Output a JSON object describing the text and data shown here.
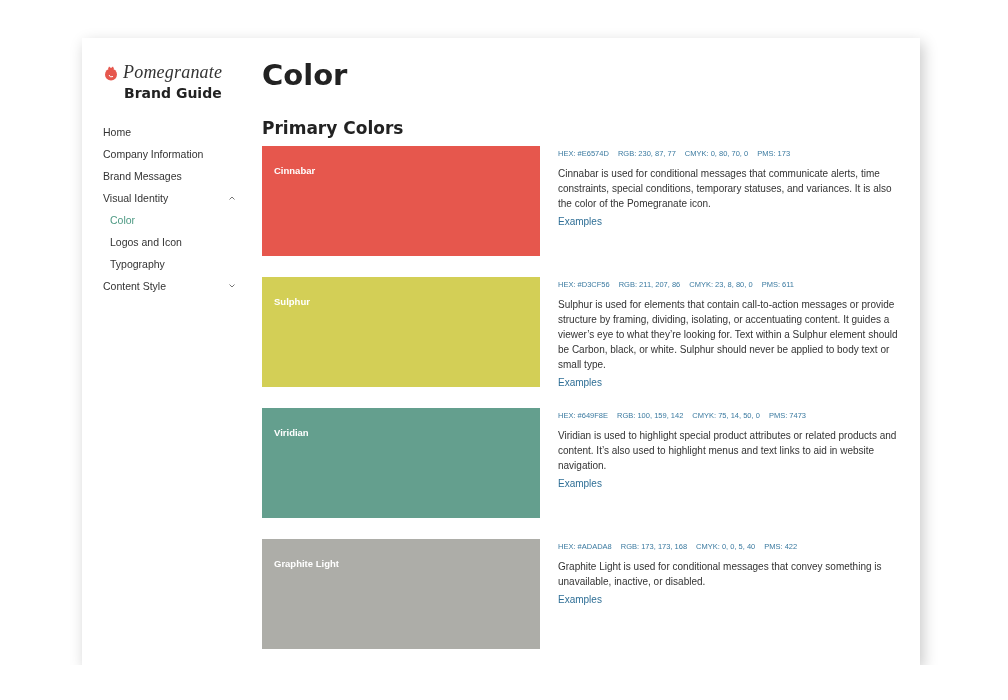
{
  "brand": {
    "name": "Pomegranate",
    "subtitle": "Brand Guide"
  },
  "nav": [
    {
      "label": "Home",
      "selected": false
    },
    {
      "label": "Company Information",
      "selected": false
    },
    {
      "label": "Brand Messages",
      "selected": false
    },
    {
      "label": "Visual Identity",
      "selected": false,
      "expanded": true,
      "children": [
        {
          "label": "Color",
          "selected": true
        },
        {
          "label": "Logos and Icon",
          "selected": false
        },
        {
          "label": "Typography",
          "selected": false
        }
      ]
    },
    {
      "label": "Content Style",
      "selected": false,
      "expanded": false
    }
  ],
  "page_title": "Color",
  "section_title": "Primary Colors",
  "colors": [
    {
      "name": "Cinnabar",
      "color": "#e6574d",
      "specs": [
        "HEX: #E6574D",
        "RGB: 230, 87, 77",
        "CMYK: 0, 80, 70, 0",
        "PMS: 173"
      ],
      "description": "Cinnabar is used for conditional messages that communicate alerts, time constraints, special conditions, temporary statuses, and variances. It is also the color of the Pomegranate icon.",
      "link": "Examples"
    },
    {
      "name": "Sulphur",
      "color": "#d3cf56",
      "specs": [
        "HEX: #D3CF56",
        "RGB: 211, 207, 86",
        "CMYK: 23, 8, 80, 0",
        "PMS: 611"
      ],
      "description": "Sulphur is used for elements that contain call-to-action messages or provide structure by framing, dividing, isolating, or accentuating content. It guides a viewer’s eye to what they’re looking for. Text within a Sulphur element should be Carbon, black, or white. Sulphur should never be applied to body text or small type.",
      "link": "Examples"
    },
    {
      "name": "Viridian",
      "color": "#649f8e",
      "specs": [
        "HEX: #649F8E",
        "RGB: 100, 159, 142",
        "CMYK: 75, 14, 50, 0",
        "PMS: 7473"
      ],
      "description": "Viridian is used to highlight special product attributes or related products and content. It’s also used to highlight menus and text links to aid in website navigation.",
      "link": "Examples"
    },
    {
      "name": "Graphite Light",
      "color": "#adada8",
      "specs": [
        "HEX: #ADADA8",
        "RGB: 173, 173, 168",
        "CMYK: 0, 0, 5, 40",
        "PMS: 422"
      ],
      "description": "Graphite Light is used for conditional messages that convey something is unavailable, inactive, or disabled.",
      "link": "Examples"
    }
  ]
}
